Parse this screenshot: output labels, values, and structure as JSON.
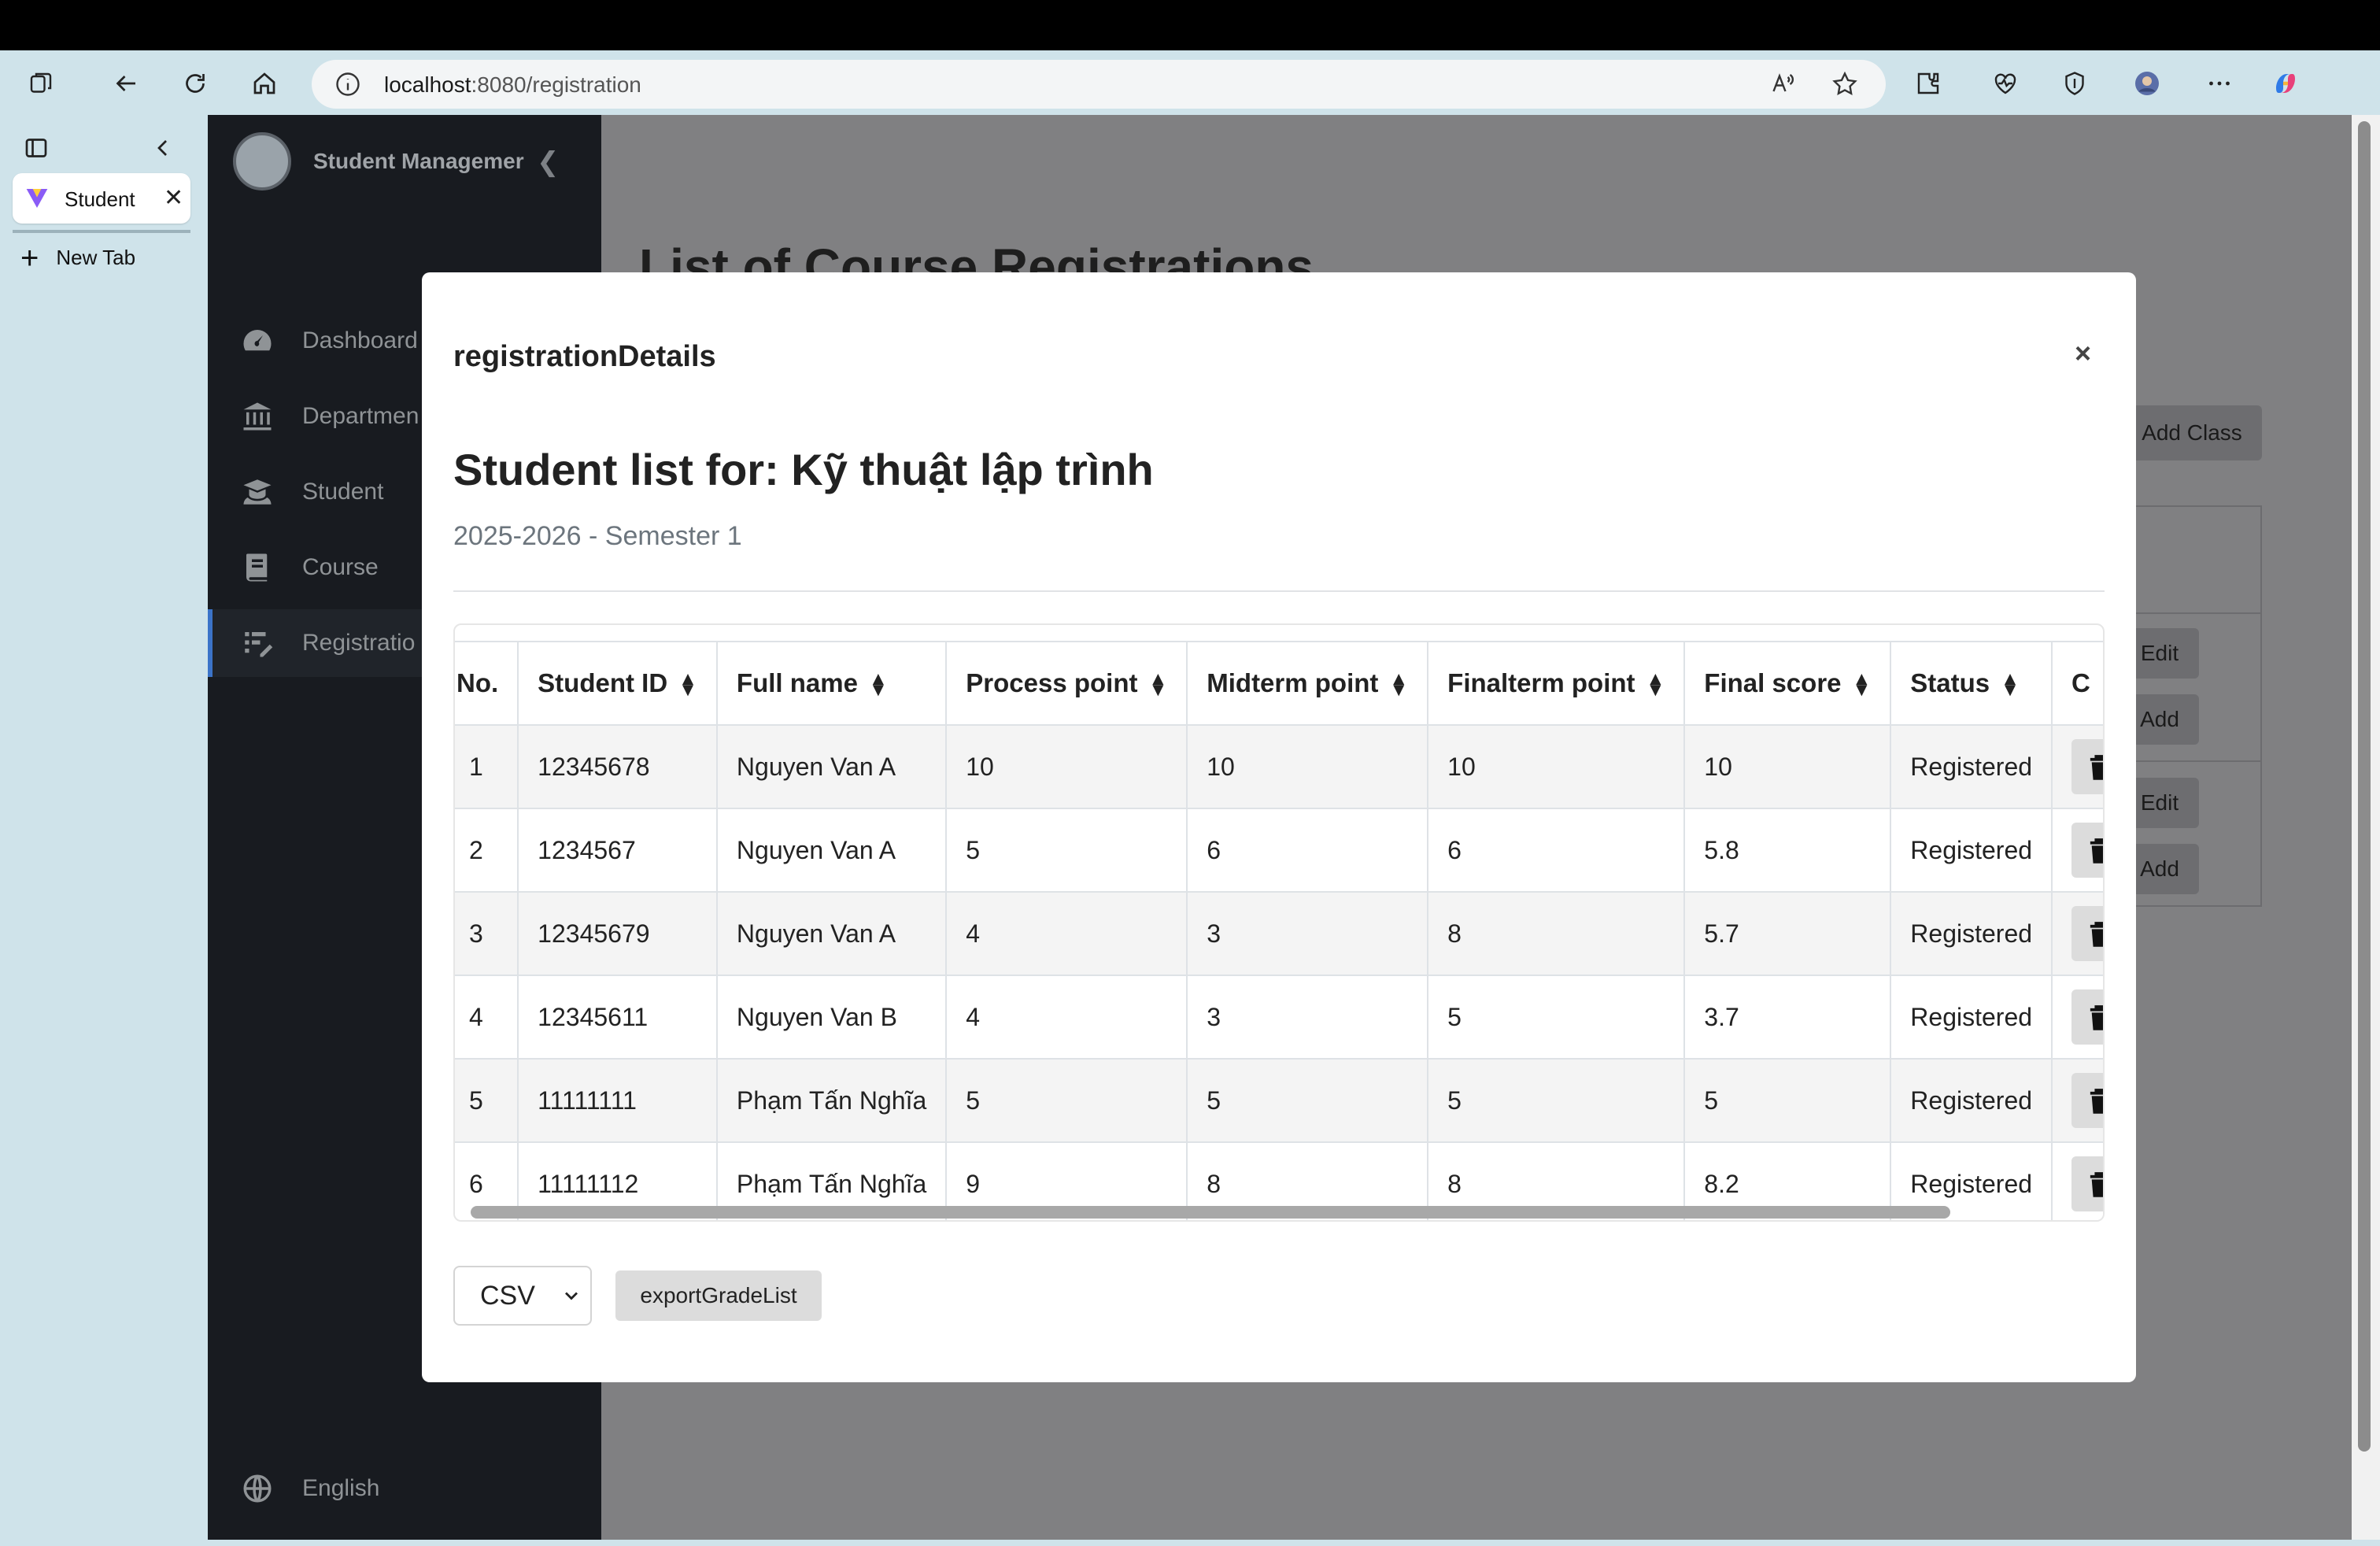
{
  "browser": {
    "url_host": "localhost",
    "url_path": ":8080/registration",
    "tab_label": "Student",
    "new_tab_label": "New Tab"
  },
  "sidebar": {
    "brand": "Student Managemer",
    "items": [
      {
        "label": "Dashboard",
        "icon": "dashboard-icon"
      },
      {
        "label": "Departmen",
        "icon": "building-icon"
      },
      {
        "label": "Student",
        "icon": "student-icon"
      },
      {
        "label": "Course",
        "icon": "book-icon"
      },
      {
        "label": "Registratio",
        "icon": "registration-icon"
      }
    ],
    "language": "English"
  },
  "background": {
    "title": "List of Course Registrations",
    "add_class": "Add Class",
    "edit_label": "Edit",
    "add_label": "Add"
  },
  "modal": {
    "title": "registrationDetails",
    "close": "×",
    "list_title": "Student list for: Kỹ thuật lập trình",
    "subtitle": "2025-2026 - Semester 1",
    "columns": [
      "No.",
      "Student ID",
      "Full name",
      "Process point",
      "Midterm point",
      "Finalterm point",
      "Final score",
      "Status",
      "C"
    ],
    "rows": [
      [
        "1",
        "12345678",
        "Nguyen Van A",
        "10",
        "10",
        "10",
        "10",
        "Registered"
      ],
      [
        "2",
        "1234567",
        "Nguyen Van A",
        "5",
        "6",
        "6",
        "5.8",
        "Registered"
      ],
      [
        "3",
        "12345679",
        "Nguyen Van A",
        "4",
        "3",
        "8",
        "5.7",
        "Registered"
      ],
      [
        "4",
        "12345611",
        "Nguyen Van B",
        "4",
        "3",
        "5",
        "3.7",
        "Registered"
      ],
      [
        "5",
        "11111111",
        "Phạm Tấn Nghĩa",
        "5",
        "5",
        "5",
        "5",
        "Registered"
      ],
      [
        "6",
        "11111112",
        "Phạm Tấn Nghĩa",
        "9",
        "8",
        "8",
        "8.2",
        "Registered"
      ]
    ],
    "format_value": "CSV",
    "export_label": "exportGradeList"
  },
  "colors": {
    "sidebar_bg": "#181b20",
    "overlay": "#808082",
    "active_accent": "#3b73c8"
  }
}
